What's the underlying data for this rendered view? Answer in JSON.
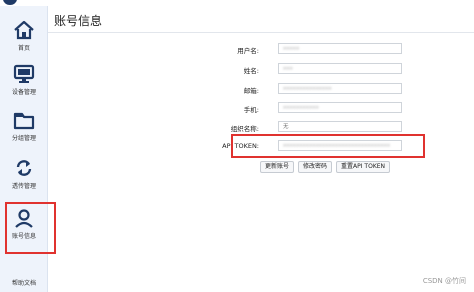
{
  "app": {
    "title": "",
    "logo_color": "#1f3a66"
  },
  "colors": {
    "sidebar_bg": "#eef3fb",
    "icon_blue": "#1f3a66",
    "highlight_red": "#e0322f"
  },
  "sidebar": {
    "items": [
      {
        "label": "首页",
        "icon": "home-icon"
      },
      {
        "label": "设备管理",
        "icon": "monitor-icon"
      },
      {
        "label": "分组管理",
        "icon": "folder-icon"
      },
      {
        "label": "透传管理",
        "icon": "sync-icon"
      },
      {
        "label": "账号信息",
        "icon": "user-icon"
      }
    ],
    "help_label": "帮助文档"
  },
  "main": {
    "page_title": "账号信息",
    "fields": [
      {
        "label": "用户名:",
        "value": "•••••"
      },
      {
        "label": "姓名:",
        "value": "•••"
      },
      {
        "label": "邮箱:",
        "value": "•••••••••••••••"
      },
      {
        "label": "手机:",
        "value": "•••••••••••"
      },
      {
        "label": "组织名称:",
        "value": "无"
      },
      {
        "label": "API TOKEN:",
        "value": "•••••••••••••••••••••••••••••••••"
      }
    ],
    "buttons": [
      "更新账号",
      "修改密码",
      "重置API TOKEN"
    ]
  },
  "watermark": "CSDN @竹间"
}
